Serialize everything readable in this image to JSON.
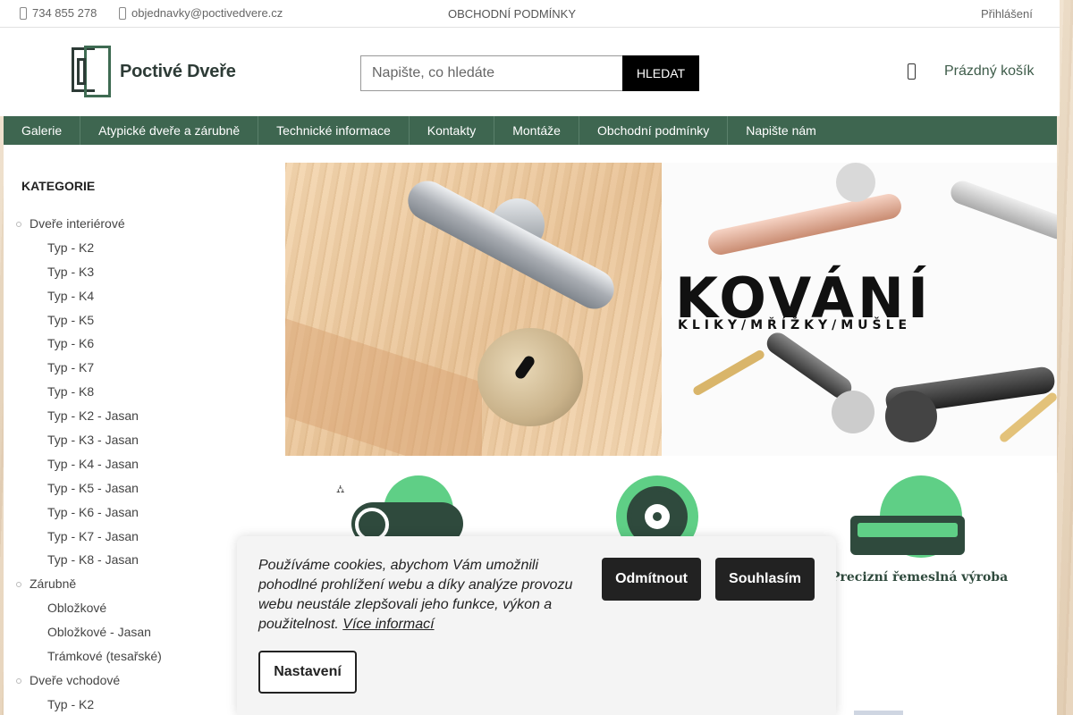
{
  "topbar": {
    "phone": "734 855 278",
    "email": "objednavky@poctivedvere.cz",
    "terms": "OBCHODNÍ PODMÍNKY",
    "login": "Přihlášení"
  },
  "header": {
    "logo_text": "Poctivé Dveře",
    "search_placeholder": "Napište, co hledáte",
    "search_button": "HLEDAT",
    "cart_label": "Prázdný košík"
  },
  "nav": {
    "items": [
      "Galerie",
      "Atypické dveře a zárubně",
      "Technické informace",
      "Kontakty",
      "Montáže",
      "Obchodní podmínky",
      "Napište nám"
    ]
  },
  "sidebar": {
    "heading": "KATEGORIE",
    "items": [
      {
        "label": "Dveře interiérové",
        "level": "top"
      },
      {
        "label": "Typ - K2",
        "level": "sub"
      },
      {
        "label": "Typ - K3",
        "level": "sub"
      },
      {
        "label": "Typ - K4",
        "level": "sub"
      },
      {
        "label": "Typ - K5",
        "level": "sub"
      },
      {
        "label": "Typ - K6",
        "level": "sub"
      },
      {
        "label": "Typ - K7",
        "level": "sub"
      },
      {
        "label": "Typ - K8",
        "level": "sub"
      },
      {
        "label": "Typ - K2 - Jasan",
        "level": "sub"
      },
      {
        "label": "Typ - K3 - Jasan",
        "level": "sub"
      },
      {
        "label": "Typ - K4 - Jasan",
        "level": "sub"
      },
      {
        "label": "Typ - K5 - Jasan",
        "level": "sub"
      },
      {
        "label": "Typ - K6 - Jasan",
        "level": "sub"
      },
      {
        "label": "Typ - K7 - Jasan",
        "level": "sub"
      },
      {
        "label": "Typ - K8 - Jasan",
        "level": "sub"
      },
      {
        "label": "Zárubně",
        "level": "top"
      },
      {
        "label": "Obložkové",
        "level": "sub"
      },
      {
        "label": "Obložkové - Jasan",
        "level": "sub"
      },
      {
        "label": "Trámkové (tesařské)",
        "level": "sub"
      },
      {
        "label": "Dveře vchodové",
        "level": "top"
      },
      {
        "label": "Typ - K2",
        "level": "sub"
      }
    ]
  },
  "banner": {
    "title": "KOVÁNÍ",
    "subtitle": "KLIKY/MŘÍŽKY/MUŠLE"
  },
  "features": {
    "third_label": "Precizní řemeslná výroba"
  },
  "cookie": {
    "message": "Používáme cookies, abychom Vám umožnili pohodlné prohlížení webu a díky analýze provozu webu neustále zlepšovali jeho funkce, výkon a použitelnost.",
    "more_link": "Více informací",
    "decline": "Odmítnout",
    "accept": "Souhlasím",
    "settings": "Nastavení"
  },
  "colors": {
    "nav_bg": "#3e6650",
    "brand_green": "#5fcf86",
    "dark_green": "#2f4a3d"
  }
}
